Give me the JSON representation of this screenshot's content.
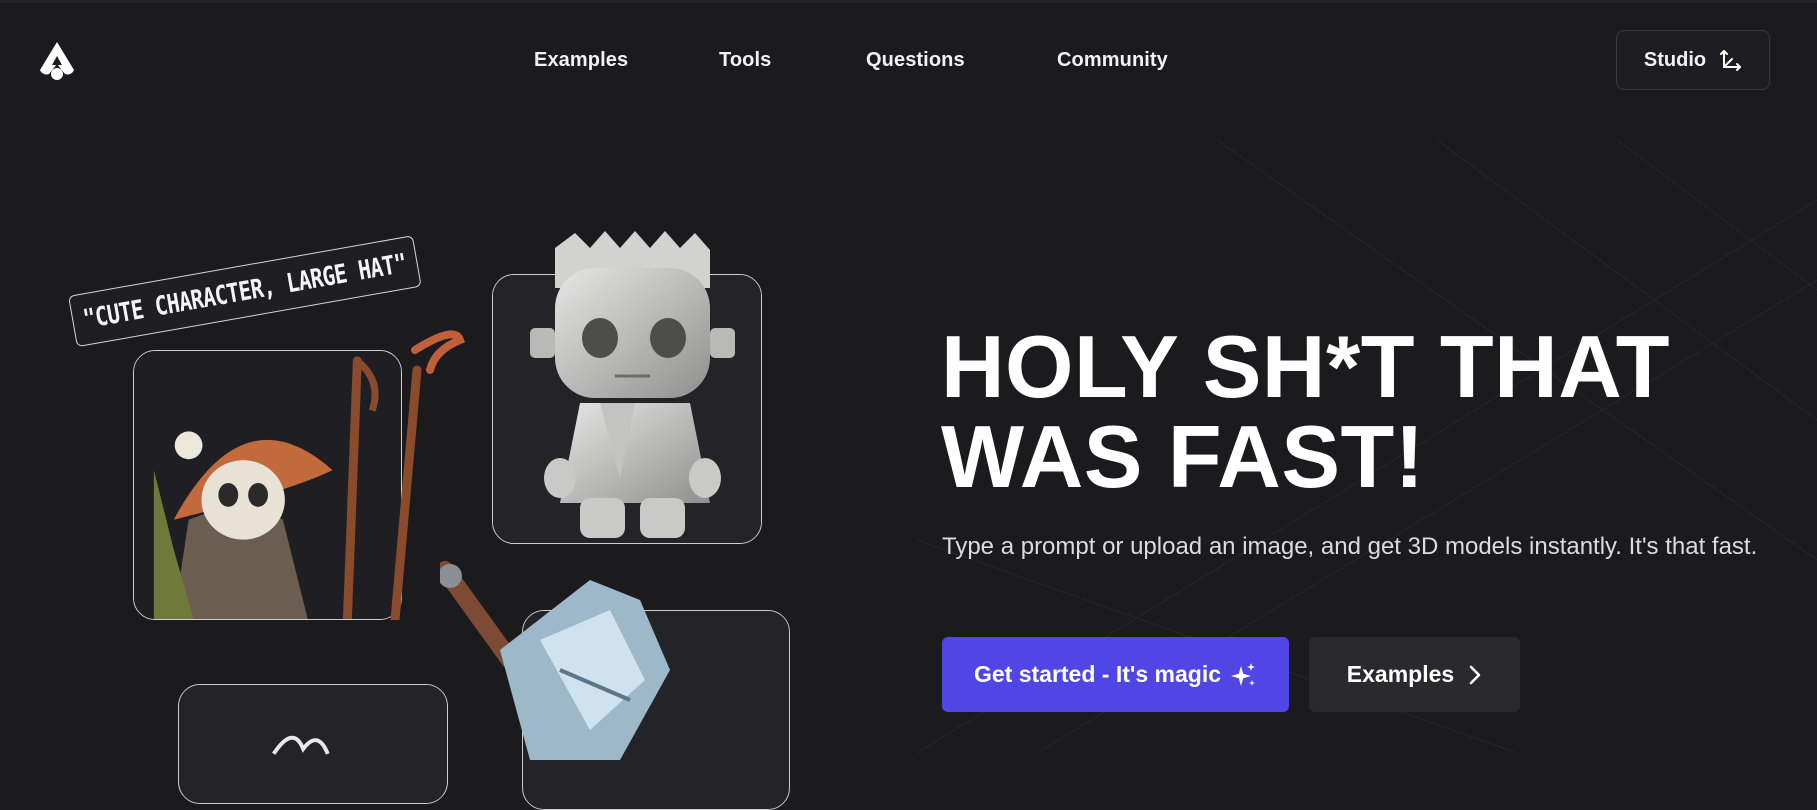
{
  "nav": {
    "logo": "logo-icon",
    "items": [
      "Examples",
      "Tools",
      "Questions",
      "Community"
    ],
    "studio_label": "Studio"
  },
  "gallery": {
    "tag_text": "\"CUTE CHARACTER, LARGE HAT\""
  },
  "hero": {
    "headline_line1": "HOLY SH*T THAT",
    "headline_line2": "WAS FAST!",
    "subtitle": "Type a prompt or upload an image, and get 3D models instantly. It's that fast.",
    "primary_button": "Get started - It's magic",
    "secondary_button": "Examples"
  },
  "colors": {
    "background": "#1b1a1d",
    "accent": "#5046e5",
    "secondary_button": "#2a292e"
  }
}
